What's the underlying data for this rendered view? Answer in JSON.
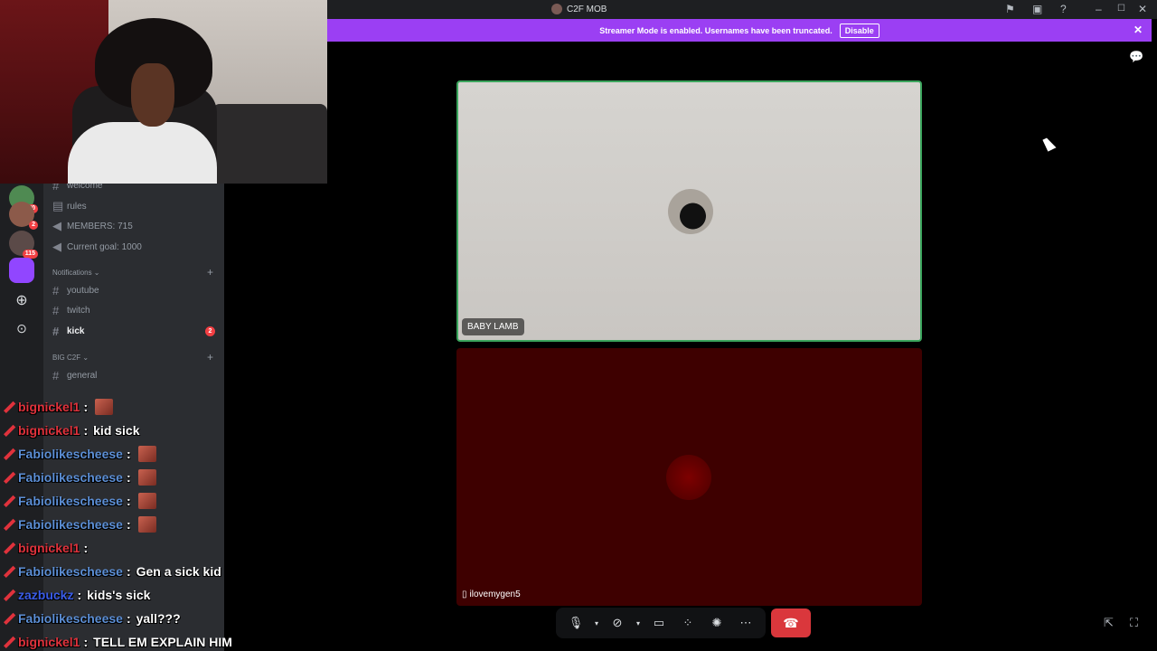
{
  "window": {
    "title": "C2F MOB",
    "icons": [
      "flag-icon",
      "inbox-icon",
      "help-icon",
      "minimize-icon",
      "maximize-icon",
      "close-icon"
    ]
  },
  "banner": {
    "text": "Streamer Mode is enabled. Usernames have been truncated.",
    "button": "Disable",
    "accent": "#9b3ff3"
  },
  "servers": [
    {
      "badge": "70"
    },
    {
      "badge": "2"
    },
    {
      "badge": "115"
    },
    {
      "badge": ""
    }
  ],
  "channels": {
    "top": [
      {
        "name": "welcome"
      },
      {
        "name": "rules"
      },
      {
        "name": "MEMBERS: 715"
      },
      {
        "name": "Current goal: 1000"
      }
    ],
    "notifications_label": "Notifications",
    "notifications": [
      {
        "name": "youtube"
      },
      {
        "name": "twitch"
      },
      {
        "name": "kick",
        "badge": "2"
      }
    ],
    "big_label": "BIG C2F",
    "big": [
      {
        "name": "general"
      }
    ]
  },
  "chat": [
    {
      "user": "bignickel1",
      "color": "#e0323c",
      "text": "",
      "emote": true
    },
    {
      "user": "bignickel1",
      "color": "#e0323c",
      "text": "kid sick",
      "emote": false
    },
    {
      "user": "Fabiolikescheese",
      "color": "#5c8fd6",
      "text": "",
      "emote": true
    },
    {
      "user": "Fabiolikescheese",
      "color": "#5c8fd6",
      "text": "",
      "emote": true
    },
    {
      "user": "Fabiolikescheese",
      "color": "#5c8fd6",
      "text": "",
      "emote": true
    },
    {
      "user": "Fabiolikescheese",
      "color": "#5c8fd6",
      "text": "",
      "emote": true
    },
    {
      "user": "bignickel1",
      "color": "#e0323c",
      "text": "",
      "emote": false
    },
    {
      "user": "Fabiolikescheese",
      "color": "#5c8fd6",
      "text": "Gen a sick kid",
      "emote": false
    },
    {
      "user": "zazbuckz",
      "color": "#3a5ce8",
      "text": "kids's sick",
      "emote": false
    },
    {
      "user": "Fabiolikescheese",
      "color": "#5c8fd6",
      "text": "yall???",
      "emote": false
    },
    {
      "user": "bignickel1",
      "color": "#e0323c",
      "text": "TELL EM EXPLAIN HIM",
      "emote": false
    }
  ],
  "call": {
    "tile1_name": "BABY LAMB",
    "tile2_name": "ilovemygen5",
    "speaking_color": "#3ba55d"
  },
  "controls": [
    "microphone-icon",
    "camera-off-icon",
    "screen-share-icon",
    "activities-icon",
    "soundboard-icon",
    "more-icon",
    "hang-up-icon"
  ]
}
